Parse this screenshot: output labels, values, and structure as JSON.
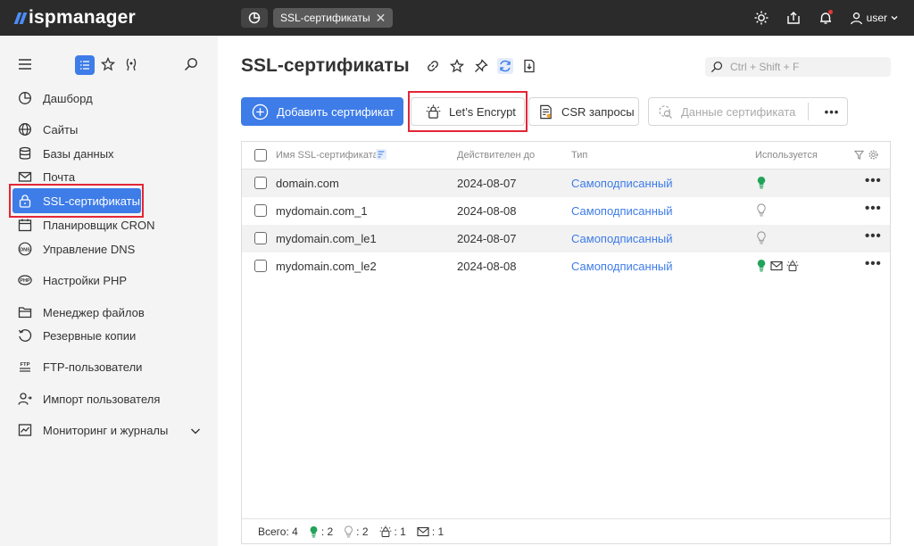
{
  "app": {
    "name": "ispmanager"
  },
  "topbar": {
    "tab_label": "SSL-сертификаты",
    "user_name": "user",
    "icons": [
      "dashboard-history-icon",
      "theme-sun-icon",
      "upload-icon",
      "notification-bell-icon",
      "user-icon"
    ]
  },
  "sidebar": {
    "tools": [
      "menu-icon",
      "list-view-icon",
      "star-icon",
      "pin-icon",
      "search-icon"
    ],
    "items": [
      {
        "label": "Дашборд",
        "icon": "dashboard-icon"
      },
      {
        "label": "Сайты",
        "icon": "globe-icon"
      },
      {
        "label": "Базы данных",
        "icon": "database-icon"
      },
      {
        "label": "Почта",
        "icon": "mail-icon"
      },
      {
        "label": "SSL-сертификаты",
        "icon": "lock-icon",
        "active": true
      },
      {
        "label": "Планировщик CRON",
        "icon": "calendar-icon"
      },
      {
        "label": "Управление DNS",
        "icon": "dns-icon"
      },
      {
        "label": "Настройки PHP",
        "icon": "php-icon"
      },
      {
        "label": "Менеджер файлов",
        "icon": "folder-icon"
      },
      {
        "label": "Резервные копии",
        "icon": "backup-icon"
      },
      {
        "label": "FTP-пользователи",
        "icon": "ftp-icon"
      },
      {
        "label": "Импорт пользователя",
        "icon": "import-user-icon"
      },
      {
        "label": "Мониторинг и журналы",
        "icon": "monitoring-icon"
      }
    ]
  },
  "main": {
    "title": "SSL-сертификаты",
    "search_placeholder": "Ctrl + Shift + F",
    "toolbar": {
      "add_label": "Добавить сертификат",
      "letsencrypt_label": "Let’s Encrypt",
      "csr_label": "CSR запросы",
      "cert_data_label": "Данные сертификата",
      "more_label": "•••"
    },
    "table": {
      "columns": [
        "Имя SSL-сертификата",
        "Действителен до",
        "Тип",
        "Используется"
      ],
      "rows": [
        {
          "name": "domain.com",
          "valid_until": "2024-08-07",
          "type": "Самоподписанный",
          "used": [
            "bulb-on-icon"
          ]
        },
        {
          "name": "mydomain.com_1",
          "valid_until": "2024-08-08",
          "type": "Самоподписанный",
          "used": [
            "bulb-off-icon"
          ]
        },
        {
          "name": "mydomain.com_le1",
          "valid_until": "2024-08-07",
          "type": "Самоподписанный",
          "used": [
            "bulb-off-icon"
          ]
        },
        {
          "name": "mydomain.com_le2",
          "valid_until": "2024-08-08",
          "type": "Самоподписанный",
          "used": [
            "bulb-on-icon",
            "mail-icon",
            "letsencrypt-icon"
          ]
        }
      ],
      "row_more_label": "•••",
      "footer": {
        "total_label": "Всего: 4",
        "used_count": ": 2",
        "unused_count": ": 2",
        "le_count": ": 1",
        "mail_count": ": 1"
      }
    }
  },
  "colors": {
    "accent": "#3e7ce8",
    "topbar": "#2b2b2b",
    "sidebar": "#f4f4f4",
    "highlight": "#e32636",
    "used_green": "#22a35a"
  }
}
